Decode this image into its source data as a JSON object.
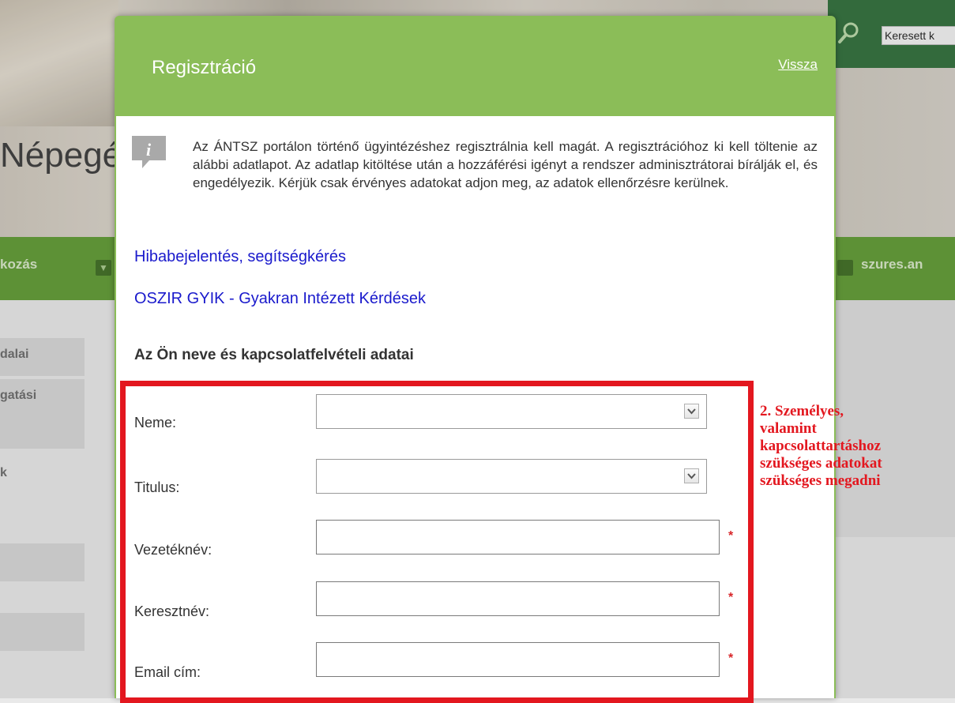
{
  "background": {
    "search_placeholder": "Keresett k",
    "site_name": "Népegé",
    "nav_left": "kozás",
    "nav_right": "szures.an",
    "sidebar_items": [
      "dalai",
      "gatási",
      "k"
    ]
  },
  "modal": {
    "title": "Regisztráció",
    "back_label": "Vissza",
    "info_text": "Az ÁNTSZ portálon történő ügyintézéshez regisztrálnia kell magát. A regisztrációhoz ki kell töltenie az alábbi adatlapot. Az adatlap kitöltése után a hozzáférési igényt a rendszer adminisztrátorai bírálják el, és engedélyezik. Kérjük csak érvényes adatokat adjon meg, az adatok ellenőrzésre kerülnek.",
    "info_icon": "info-icon",
    "link_report": "Hibabejelentés, segítségkérés",
    "link_faq": "OSZIR GYIK - Gyakran Intézett Kérdések",
    "section_title": "Az Ön neve és kapcsolatfelvételi adatai",
    "fields": {
      "gender": {
        "label": "Neme:",
        "value": ""
      },
      "title": {
        "label": "Titulus:",
        "value": ""
      },
      "lastname": {
        "label": "Vezetéknév:",
        "value": "",
        "required": "*"
      },
      "firstname": {
        "label": "Keresztnév:",
        "value": "",
        "required": "*"
      },
      "email": {
        "label": "Email cím:",
        "value": "",
        "required": "*"
      }
    }
  },
  "annotation": {
    "text": "2. Személyes,\nvalamint\nkapcsolattartáshoz\nszükséges adatokat\nszükséges megadni",
    "color": "#e3171f"
  },
  "colors": {
    "modal_header": "#8bbd58",
    "link": "#1a1acc",
    "required": "#d8262a",
    "nav_green": "#5f9a33"
  }
}
